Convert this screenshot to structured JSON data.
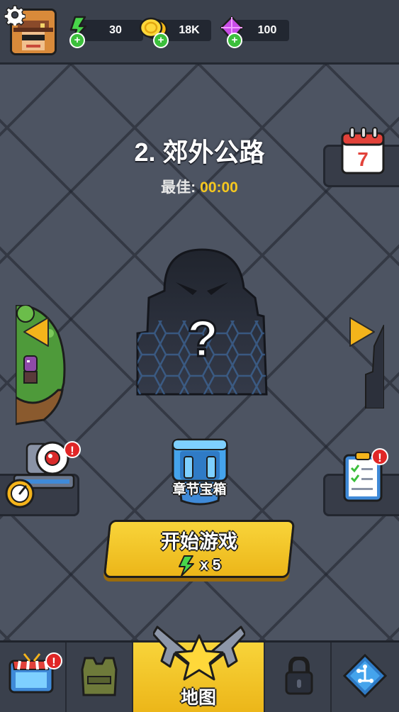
{
  "resources": {
    "energy": {
      "value": "30",
      "icon": "lightning-icon"
    },
    "coins": {
      "value": "18K",
      "icon": "gold-coin-icon"
    },
    "gems": {
      "value": "100",
      "icon": "purple-gem-icon"
    }
  },
  "level": {
    "title": "2. 郊外公路",
    "best_label": "最佳:",
    "best_time": "00:00",
    "boss_mystery": "?"
  },
  "calendar": {
    "day": "7"
  },
  "chest": {
    "label": "章节宝箱"
  },
  "start_button": {
    "label": "开始游戏",
    "cost": "x 5"
  },
  "badges": {
    "alert": "!"
  },
  "bottom_nav": {
    "items": [
      {
        "name": "shop",
        "icon": "shop-tv-icon"
      },
      {
        "name": "equipment",
        "icon": "armor-vest-icon"
      },
      {
        "name": "map",
        "label": "地图",
        "icon": "star-guns-icon"
      },
      {
        "name": "locked",
        "icon": "padlock-icon"
      },
      {
        "name": "talents",
        "icon": "circuit-gem-icon"
      }
    ]
  },
  "colors": {
    "accent_yellow": "#f6c81f",
    "button_yellow": "#ecb619",
    "badge_red": "#e02626",
    "plus_green": "#3cbf3c",
    "background": "#4d5462"
  }
}
